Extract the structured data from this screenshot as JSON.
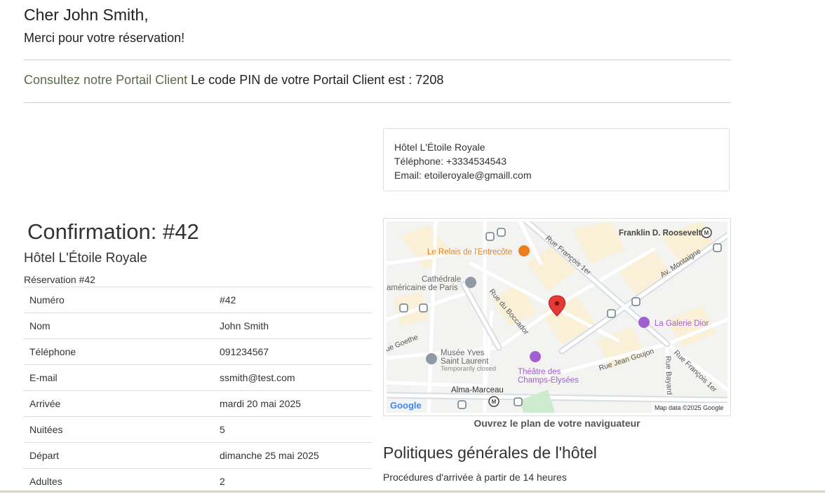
{
  "greeting": "Cher John Smith,",
  "thanks": "Merci pour votre réservation!",
  "portal": {
    "link_text": "Consultez notre Portail Client",
    "pin_text": "Le code PIN de votre Portail Client est : 7208"
  },
  "hotel_contact": {
    "name": "Hôtel L'Étoile Royale",
    "phone": "Téléphone: +3334534543",
    "email": "Email: etoileroyale@gmaill.com"
  },
  "confirmation": {
    "title": "Confirmation: #42",
    "hotel": "Hôtel L'Étoile Royale",
    "caption": "Réservation #42",
    "rows": [
      {
        "key": "Numéro",
        "value": "#42"
      },
      {
        "key": "Nom",
        "value": "John Smith"
      },
      {
        "key": "Téléphone",
        "value": "091234567"
      },
      {
        "key": "E-mail",
        "value": "ssmith@test.com"
      },
      {
        "key": "Arrivée",
        "value": "mardi 20 mai 2025"
      },
      {
        "key": "Nuitées",
        "value": "5"
      },
      {
        "key": "Départ",
        "value": "dimanche 25 mai 2025"
      },
      {
        "key": "Adultes",
        "value": "2"
      }
    ]
  },
  "map": {
    "labels": {
      "roosevelt": "Franklin D. Roosevelt",
      "relais": "Le Relais de l'Entrecôte",
      "rue_francois_1": "Rue François 1er",
      "av_montaigne": "Av. Montaigne",
      "cathedrale_1": "Cathédrale",
      "cathedrale_2": "américaine de Paris",
      "boccador": "Rue du Boccador",
      "galerie": "La Galerie Dior",
      "goethe": "ue Goethe",
      "musee_1": "Musée Yves",
      "musee_2": "Saint Laurent",
      "musee_3": "Temporarily closed",
      "theatre_1": "Théâtre des",
      "theatre_2": "Champs-Elysées",
      "jean_goujon": "Rue Jean Goujon",
      "bayard": "Rue Bayard",
      "rue_francois_2": "Rue François 1er",
      "alma": "Alma-Marceau",
      "google": "Google",
      "attribution": "Map data ©2025 Google"
    },
    "open_link": "Ouvrez le plan de votre naviguateur"
  },
  "policies": {
    "title": "Politiques générales de l'hôtel",
    "checkin": "Procédures d'arrivée à partir de 14 heures"
  },
  "colors": {
    "link": "#5c6b4e",
    "map_road": "#ffffff",
    "map_land": "#f3f3f1",
    "map_block": "#faf0d8",
    "map_pin": "#e53935",
    "poi_food": "#e8801e",
    "poi_shop": "#a25fd0",
    "poi_gray": "#8f9aa5"
  }
}
